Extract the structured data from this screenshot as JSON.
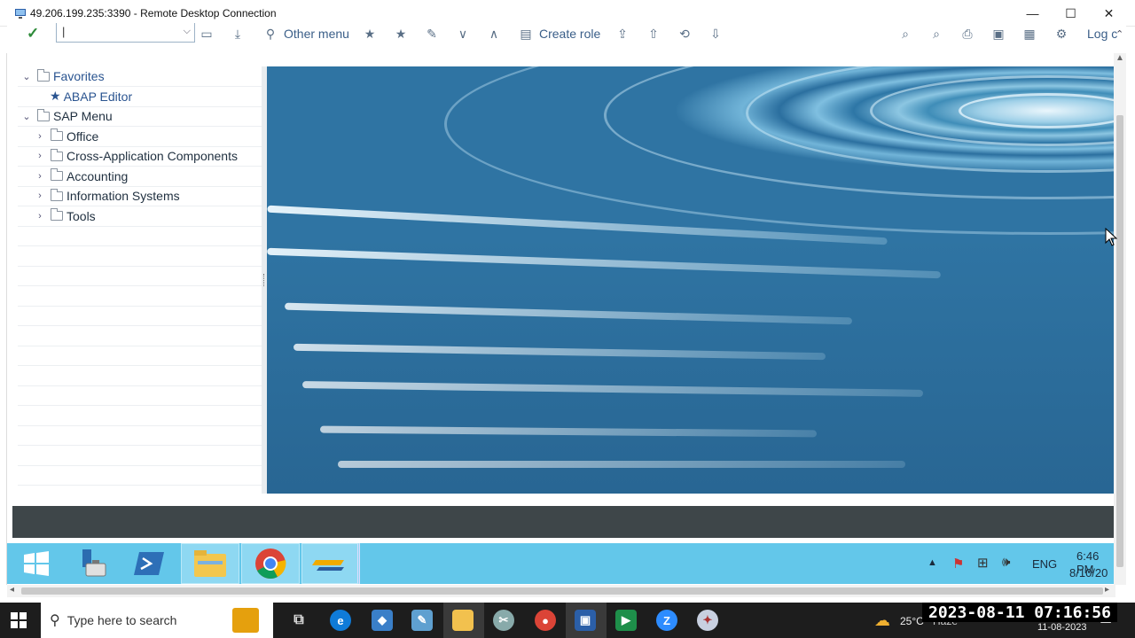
{
  "window": {
    "title": "49.206.199.235:3390 - Remote Desktop Connection"
  },
  "toolbar": {
    "other_menu": "Other menu",
    "create_role": "Create role",
    "log_off": "Log c"
  },
  "tree": {
    "favorites": "Favorites",
    "abap_editor": "ABAP Editor",
    "sap_menu": "SAP Menu",
    "items": [
      {
        "label": "Office"
      },
      {
        "label": "Cross-Application Components"
      },
      {
        "label": "Accounting"
      },
      {
        "label": "Information Systems"
      },
      {
        "label": "Tools"
      }
    ]
  },
  "remote_taskbar": {
    "language": "ENG",
    "time": "6:46 PM",
    "date": "8/10/20"
  },
  "local_taskbar": {
    "search_placeholder": "Type here to search",
    "weather": "25°C",
    "weather_desc": "Haze",
    "date": "11-08-2023"
  },
  "overlay": {
    "timestamp": "2023-08-11 07:16:56"
  },
  "colors": {
    "accent": "#63c7ea",
    "status_bar": "#3e4649",
    "sap_link": "#2a5490",
    "ok_check": "#2e8b3a"
  }
}
